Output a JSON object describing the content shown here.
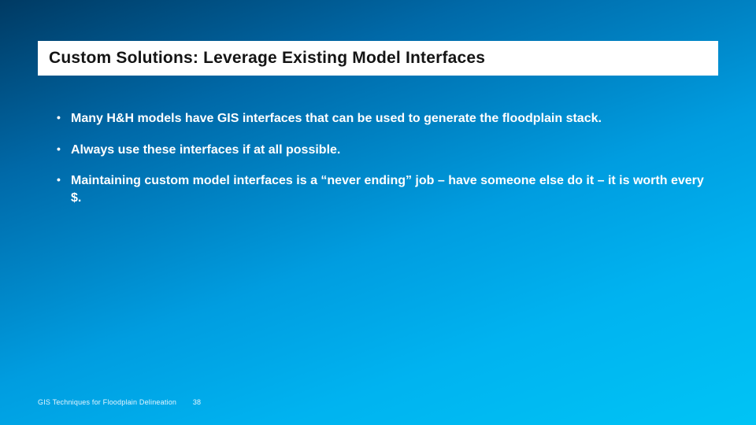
{
  "slide": {
    "title": "Custom Solutions: Leverage Existing Model Interfaces",
    "bullets": [
      "Many H&H models have GIS interfaces that can be used to generate the floodplain stack.",
      "Always use these interfaces if at all possible.",
      "Maintaining custom model interfaces is a “never ending” job – have someone else do it – it is worth every $."
    ],
    "footer": {
      "label": "GIS Techniques for Floodplain Delineation",
      "page": "38"
    }
  }
}
